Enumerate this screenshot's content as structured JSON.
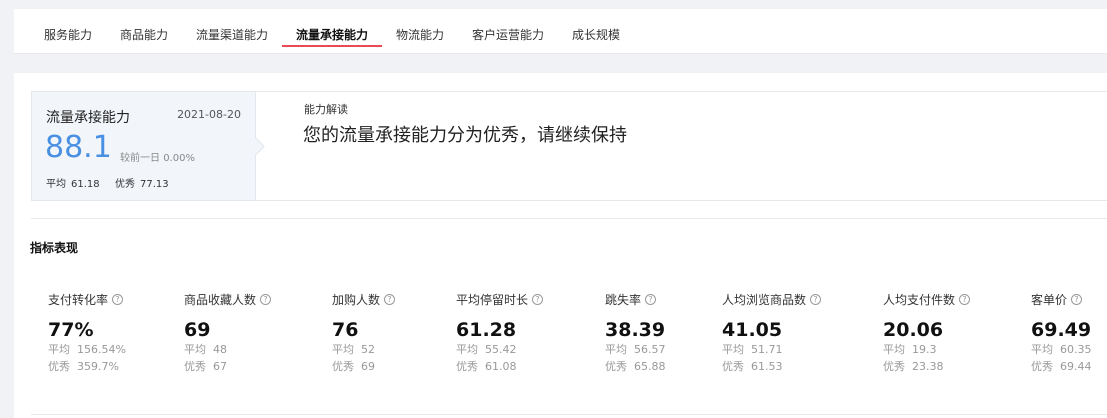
{
  "tabs": [
    {
      "label": "服务能力",
      "active": false
    },
    {
      "label": "商品能力",
      "active": false
    },
    {
      "label": "流量渠道能力",
      "active": false
    },
    {
      "label": "流量承接能力",
      "active": true
    },
    {
      "label": "物流能力",
      "active": false
    },
    {
      "label": "客户运营能力",
      "active": false
    },
    {
      "label": "成长规模",
      "active": false
    }
  ],
  "accent_color": "#e94a55",
  "score_color": "#4a90e2",
  "score_card": {
    "title": "流量承接能力",
    "date": "2021-08-20",
    "score": "88.1",
    "compare_label": "较前一日",
    "compare_value": "0.00%",
    "avg_label": "平均",
    "avg_value": "61.18",
    "excellent_label": "优秀",
    "excellent_value": "77.13"
  },
  "interpretation": {
    "label": "能力解读",
    "text": "您的流量承接能力分为优秀，请继续保持"
  },
  "metrics_section": {
    "title": "指标表现",
    "avg_label": "平均",
    "excellent_label": "优秀",
    "help_icon": "question-circle-icon",
    "metrics": [
      {
        "name": "支付转化率",
        "value": "77%",
        "avg": "156.54%",
        "excellent": "359.7%"
      },
      {
        "name": "商品收藏人数",
        "value": "69",
        "avg": "48",
        "excellent": "67"
      },
      {
        "name": "加购人数",
        "value": "76",
        "avg": "52",
        "excellent": "69"
      },
      {
        "name": "平均停留时长",
        "value": "61.28",
        "avg": "55.42",
        "excellent": "61.08"
      },
      {
        "name": "跳失率",
        "value": "38.39",
        "avg": "56.57",
        "excellent": "65.88"
      },
      {
        "name": "人均浏览商品数",
        "value": "41.05",
        "avg": "51.71",
        "excellent": "61.53"
      },
      {
        "name": "人均支付件数",
        "value": "20.06",
        "avg": "19.3",
        "excellent": "23.38"
      },
      {
        "name": "客单价",
        "value": "69.49",
        "avg": "60.35",
        "excellent": "69.44"
      }
    ]
  }
}
